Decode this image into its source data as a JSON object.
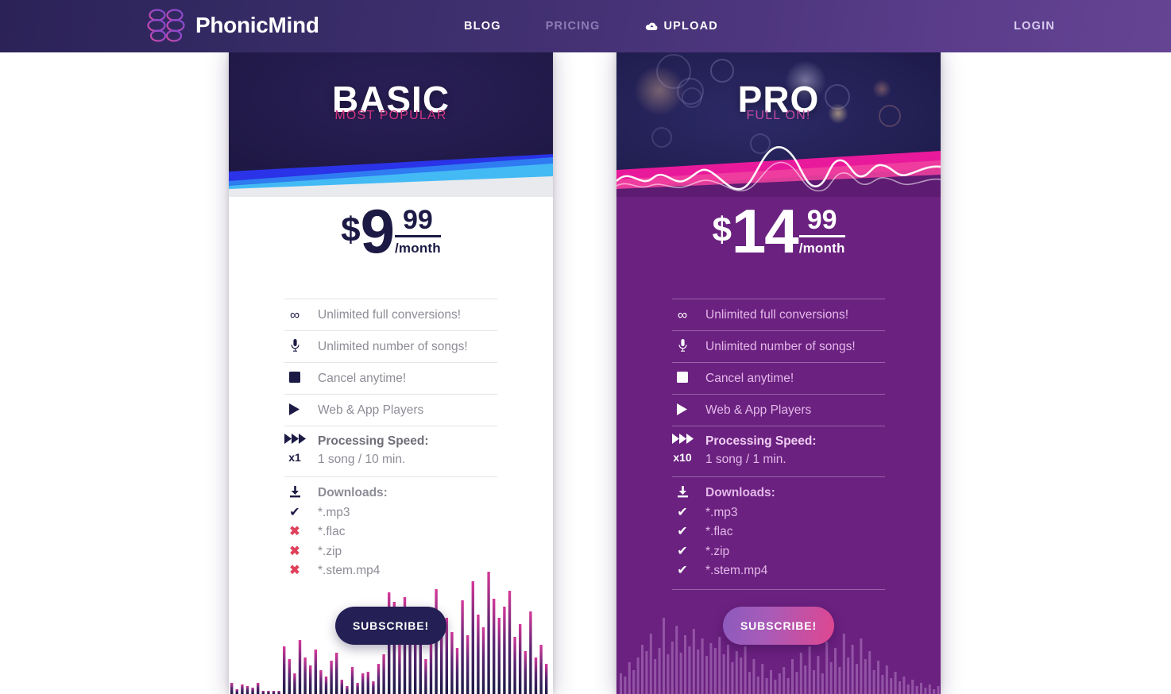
{
  "header": {
    "brand": "PhonicMind",
    "logo_icon": "brain-logo-icon",
    "nav": [
      {
        "label": "BLOG",
        "name": "nav-blog",
        "state": "default"
      },
      {
        "label": "PRICING",
        "name": "nav-pricing",
        "state": "active"
      },
      {
        "label": "UPLOAD",
        "name": "nav-upload",
        "state": "default",
        "icon": "cloud-upload-icon"
      }
    ],
    "login_label": "LOGIN",
    "colors": {
      "gradient_start": "#2b2258",
      "gradient_end": "#654493"
    }
  },
  "plans": [
    {
      "id": "basic",
      "title": "BASIC",
      "subtitle": "MOST POPULAR",
      "currency": "$",
      "amount": "9",
      "cents": "99",
      "period": "/month",
      "features": [
        {
          "icon": "infinity-icon",
          "glyph": "∞",
          "text": "Unlimited full conversions!"
        },
        {
          "icon": "microphone-icon",
          "glyph": "🎙",
          "text": "Unlimited number of songs!"
        },
        {
          "icon": "stop-square-icon",
          "glyph": "■",
          "text": "Cancel anytime!"
        },
        {
          "icon": "play-triangle-icon",
          "glyph": "▶",
          "text": "Web & App Players"
        }
      ],
      "speed": {
        "icon": "fast-forward-icon",
        "multiplier": "x1",
        "heading": "Processing Speed:",
        "detail": "1 song / 10 min."
      },
      "downloads": {
        "icon": "download-icon",
        "heading": "Downloads:",
        "items": [
          {
            "label": "*.mp3",
            "included": true
          },
          {
            "label": "*.flac",
            "included": false
          },
          {
            "label": "*.zip",
            "included": false
          },
          {
            "label": "*.stem.mp4",
            "included": false
          }
        ]
      },
      "cta": "SUBSCRIBE!",
      "colors": {
        "body_bg": "#ffffff",
        "accent": "#1c1a45",
        "sub_color": "#d0337f",
        "button": "#241f54"
      }
    },
    {
      "id": "pro",
      "title": "PRO",
      "subtitle": "FULL ON!",
      "currency": "$",
      "amount": "14",
      "cents": "99",
      "period": "/month",
      "features": [
        {
          "icon": "infinity-icon",
          "glyph": "∞",
          "text": "Unlimited full conversions!"
        },
        {
          "icon": "microphone-icon",
          "glyph": "🎙",
          "text": "Unlimited number of songs!"
        },
        {
          "icon": "stop-square-icon",
          "glyph": "■",
          "text": "Cancel anytime!"
        },
        {
          "icon": "play-triangle-icon",
          "glyph": "▶",
          "text": "Web & App Players"
        }
      ],
      "speed": {
        "icon": "fast-forward-icon",
        "multiplier": "x10",
        "heading": "Processing Speed:",
        "detail": "1 song / 1 min."
      },
      "downloads": {
        "icon": "download-icon",
        "heading": "Downloads:",
        "items": [
          {
            "label": "*.mp3",
            "included": true
          },
          {
            "label": "*.flac",
            "included": true
          },
          {
            "label": "*.zip",
            "included": true
          },
          {
            "label": "*.stem.mp4",
            "included": true
          }
        ]
      },
      "cta": "SUBSCRIBE!",
      "colors": {
        "body_bg": "#6b2180",
        "accent": "#ffffff",
        "sub_color": "#c34ba0",
        "button_start": "#8b5bbd",
        "button_end": "#e0468f"
      }
    }
  ],
  "check_glyph": "✔",
  "cross_glyph": "✖",
  "page_bg": "#ffffff"
}
